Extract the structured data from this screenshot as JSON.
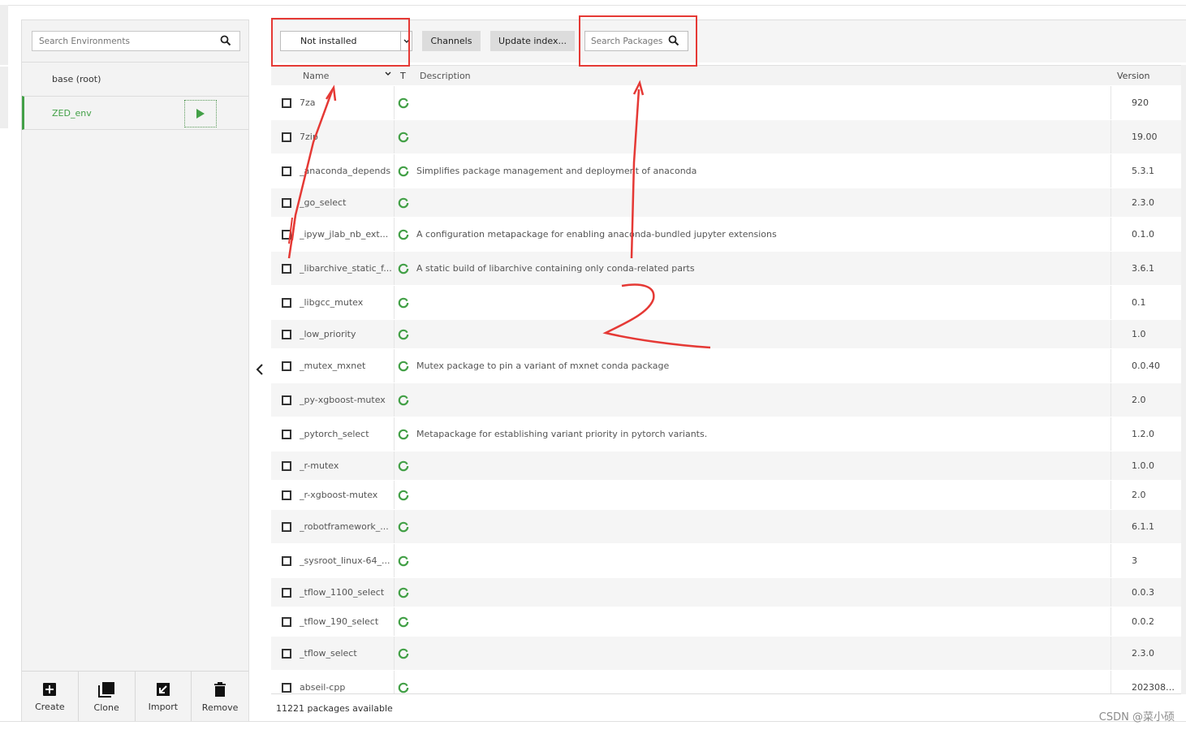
{
  "environments": {
    "search_placeholder": "Search Environments",
    "items": [
      {
        "label": "base (root)",
        "active": false
      },
      {
        "label": "ZED_env",
        "active": true
      }
    ],
    "actions": [
      {
        "label": "Create",
        "icon": "plus-square-icon"
      },
      {
        "label": "Clone",
        "icon": "clone-icon"
      },
      {
        "label": "Import",
        "icon": "import-icon"
      },
      {
        "label": "Remove",
        "icon": "trash-icon"
      }
    ]
  },
  "toolbar": {
    "filter_value": "Not installed",
    "channels_label": "Channels",
    "update_label": "Update index...",
    "search_placeholder": "Search Packages"
  },
  "table": {
    "headers": {
      "name": "Name",
      "type": "T",
      "description": "Description",
      "version": "Version"
    },
    "rows": [
      {
        "name": "7za",
        "description": "",
        "version": "920"
      },
      {
        "name": "7zip",
        "description": "",
        "version": "19.00"
      },
      {
        "name": "_anaconda_depends",
        "description": "Simplifies package management and deployment of anaconda",
        "version": "5.3.1"
      },
      {
        "name": "_go_select",
        "description": "",
        "version": "2.3.0"
      },
      {
        "name": "_ipyw_jlab_nb_ext...",
        "description": "A configuration metapackage for enabling anaconda-bundled jupyter extensions",
        "version": "0.1.0"
      },
      {
        "name": "_libarchive_static_f...",
        "description": "A static build of libarchive containing only conda-related parts",
        "version": "3.6.1"
      },
      {
        "name": "_libgcc_mutex",
        "description": "",
        "version": "0.1"
      },
      {
        "name": "_low_priority",
        "description": "",
        "version": "1.0"
      },
      {
        "name": "_mutex_mxnet",
        "description": "Mutex package to pin a variant of mxnet conda package",
        "version": "0.0.40"
      },
      {
        "name": "_py-xgboost-mutex",
        "description": "",
        "version": "2.0"
      },
      {
        "name": "_pytorch_select",
        "description": "Metapackage for establishing variant priority in pytorch variants.",
        "version": "1.2.0"
      },
      {
        "name": "_r-mutex",
        "description": "",
        "version": "1.0.0"
      },
      {
        "name": "_r-xgboost-mutex",
        "description": "",
        "version": "2.0"
      },
      {
        "name": "_robotframework_...",
        "description": "",
        "version": "6.1.1"
      },
      {
        "name": "_sysroot_linux-64_...",
        "description": "",
        "version": "3"
      },
      {
        "name": "_tflow_1100_select",
        "description": "",
        "version": "0.0.3"
      },
      {
        "name": "_tflow_190_select",
        "description": "",
        "version": "0.0.2"
      },
      {
        "name": "_tflow_select",
        "description": "",
        "version": "2.3.0"
      },
      {
        "name": "abseil-cpp",
        "description": "",
        "version": "2023080..."
      }
    ]
  },
  "footer": {
    "status": "11221 packages available"
  },
  "watermark": "CSDN @菜小硕",
  "colors": {
    "accent": "#43a047",
    "annotation": "#e53935"
  }
}
